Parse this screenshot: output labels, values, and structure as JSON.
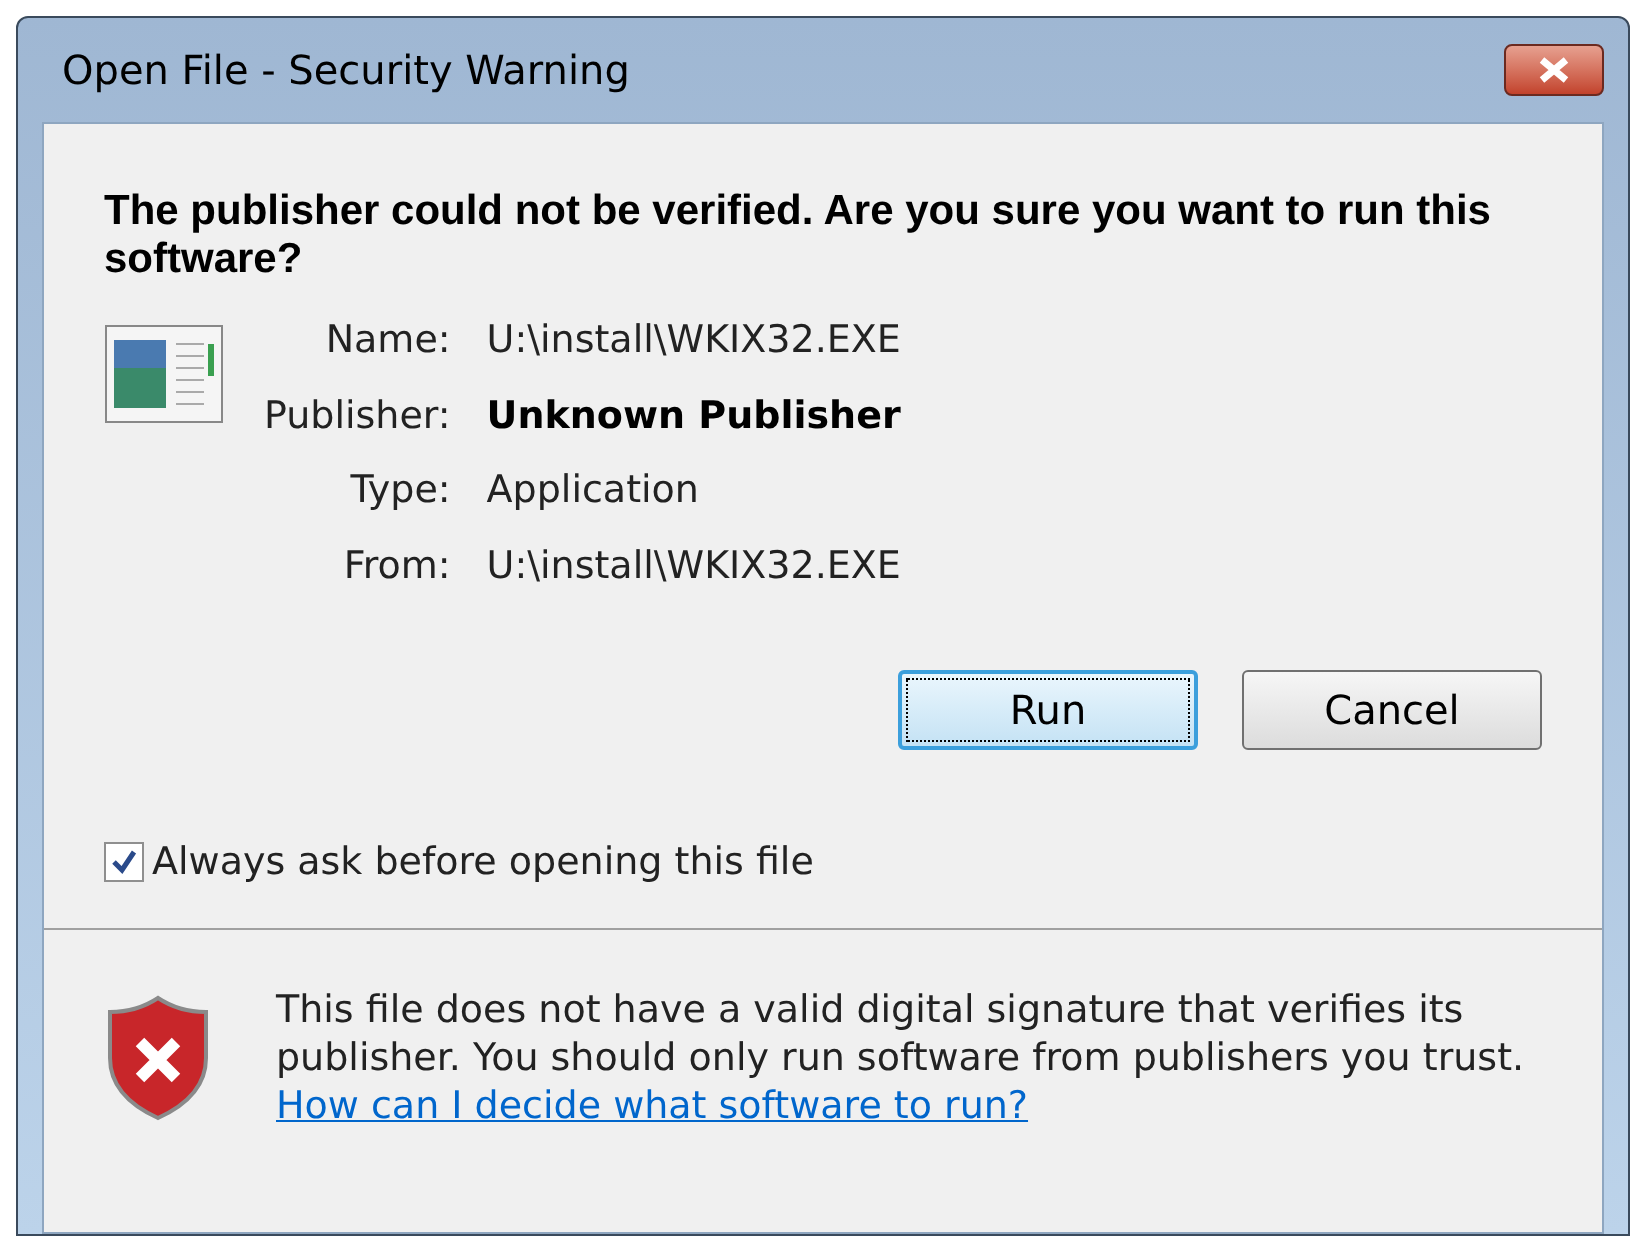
{
  "window": {
    "title": "Open File - Security Warning"
  },
  "heading": "The publisher could not be verified.  Are you sure you want to run this software?",
  "details": [
    {
      "label": "Name:",
      "value": "U:\\install\\WKIX32.EXE",
      "bold": false
    },
    {
      "label": "Publisher:",
      "value": "Unknown Publisher",
      "bold": true
    },
    {
      "label": "Type:",
      "value": "Application",
      "bold": false
    },
    {
      "label": "From:",
      "value": "U:\\install\\WKIX32.EXE",
      "bold": false
    }
  ],
  "buttons": [
    {
      "label": "Run",
      "focused": true
    },
    {
      "label": "Cancel",
      "focused": false
    }
  ],
  "checkbox": {
    "label": "Always ask before opening this file",
    "checked": true
  },
  "footer": {
    "message": "This file does not have a valid digital signature that verifies its publisher.  You should only run software from publishers you trust.",
    "link": "How can I decide what software to run?"
  }
}
